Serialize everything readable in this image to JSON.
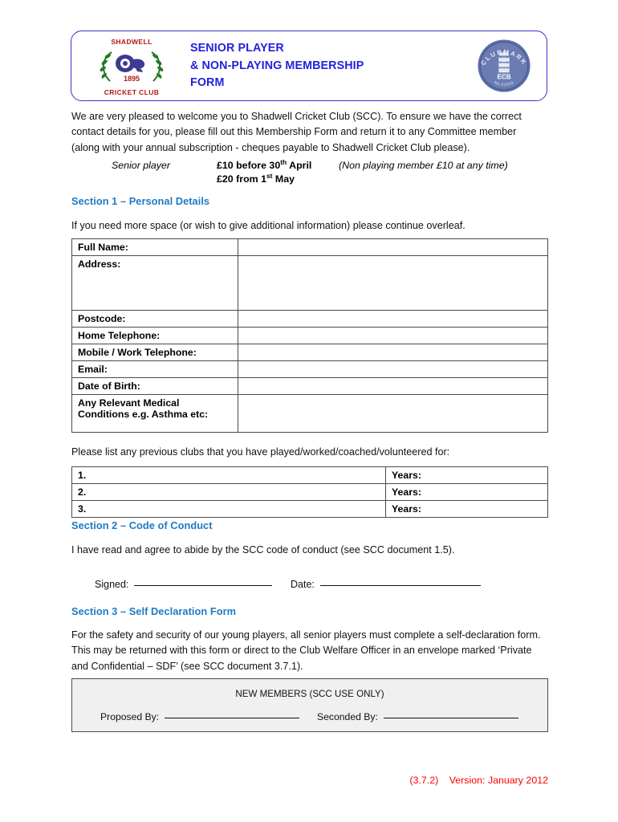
{
  "header": {
    "title_lines": [
      "SENIOR PLAYER",
      "& NON-PLAYING MEMBERSHIP",
      "FORM"
    ],
    "club_logo": {
      "top_text": "SHADWELL",
      "bottom_text": "CRICKET CLUB",
      "year": "1895"
    },
    "clubmark_badge": {
      "arch_text": "CLUBMARK",
      "body_text": "ECB",
      "number_text": "No.01524"
    },
    "border_color": "#3333cc",
    "title_color": "#2222dd"
  },
  "intro": {
    "paragraph": "We are very pleased to welcome you to Shadwell Cricket Club (SCC). To ensure we have the correct contact details for you, please fill out this Membership Form and return it to any Committee member (along with your annual subscription - cheques payable to Shadwell Cricket Club please)."
  },
  "fees": {
    "label": "Senior player",
    "line1_pre": "£10 before 30",
    "line1_sup": "th",
    "line1_post": " April",
    "line2_pre": "£20 from 1",
    "line2_sup": "st",
    "line2_post": " May",
    "note": "(Non playing member £10 at any time)"
  },
  "sections": {
    "section1": {
      "heading": "Section 1 – Personal Details",
      "note": "If you need more space (or wish to give additional information) please continue overleaf."
    },
    "section2": {
      "heading": "Section 2 – Code of Conduct",
      "paragraph": "I have read and agree to abide by the SCC code of conduct (see SCC document 1.5).",
      "signed_label": "Signed:",
      "date_label": "Date:"
    },
    "section3": {
      "heading": "Section 3 – Self Declaration Form",
      "paragraph": "For the safety and security of our young players, all senior players must complete a self-declaration form. This may be returned with this form or direct to the Club Welfare Officer in an envelope marked ‘Private and Confidential – SDF’ (see SCC document 3.7.1)."
    },
    "heading_color": "#1f7ac4"
  },
  "details_table": {
    "rows": [
      {
        "label": "Full Name:",
        "value": ""
      },
      {
        "label": "Address:",
        "value": ""
      },
      {
        "label": "Postcode:",
        "value": ""
      },
      {
        "label": "Home Telephone:",
        "value": ""
      },
      {
        "label": "Mobile / Work Telephone:",
        "value": ""
      },
      {
        "label": "Email:",
        "value": ""
      },
      {
        "label": "Date of Birth:",
        "value": ""
      },
      {
        "label_line1": "Any Relevant Medical",
        "label_line2": "Conditions e.g. Asthma etc:",
        "value": ""
      }
    ]
  },
  "previous_clubs": {
    "note": "Please list any previous clubs that you have played/worked/coached/volunteered for:",
    "rows": [
      {
        "num": "1.",
        "years": "Years:",
        "club": ""
      },
      {
        "num": "2.",
        "years": "Years:",
        "club": ""
      },
      {
        "num": "3.",
        "years": "Years:",
        "club": ""
      }
    ]
  },
  "new_members": {
    "title": "NEW MEMBERS (SCC USE ONLY)",
    "proposed_label": "Proposed By:",
    "seconded_label": "Seconded By:",
    "background_color": "#f0f0f0"
  },
  "footer": {
    "doc_ref": "(3.7.2)",
    "version": "Version: January 2012",
    "color": "#ff0000"
  }
}
